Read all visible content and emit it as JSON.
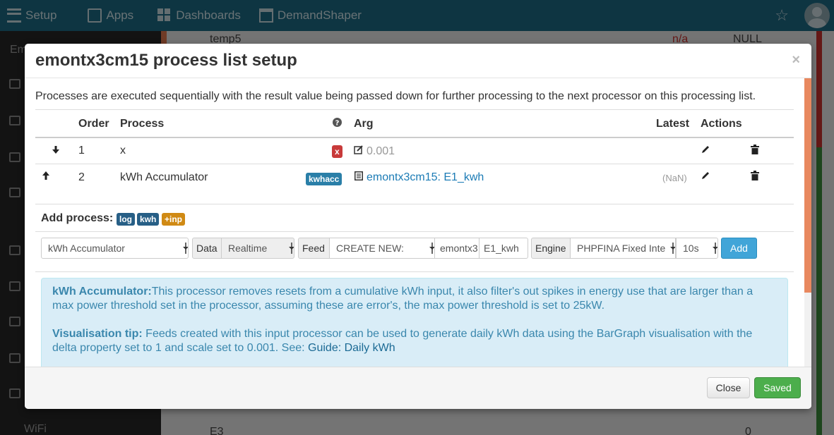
{
  "topnav": {
    "setup": "Setup",
    "apps": "Apps",
    "dashboards": "Dashboards",
    "demandshaper": "DemandShaper"
  },
  "background": {
    "sidebar_partial": "Em",
    "sidebar_wifi": "WiFi",
    "row_top_name": "temp5",
    "row_top_value": "n/a",
    "row_top_null": "NULL",
    "row_bottom_name": "E3",
    "row_bottom_value": "0"
  },
  "modal": {
    "title": "emontx3cm15 process list setup",
    "close_symbol": "×",
    "intro": "Processes are executed sequentially with the result value being passed down for further processing to the next processor on this processing list.",
    "table": {
      "headers": {
        "order": "Order",
        "process": "Process",
        "arg": "Arg",
        "latest": "Latest",
        "actions": "Actions"
      },
      "rows": [
        {
          "order": "1",
          "process": "x",
          "badge": "x",
          "arg": "0.001",
          "latest": ""
        },
        {
          "order": "2",
          "process": "kWh Accumulator",
          "badge": "kwhacc",
          "arg": "emontx3cm15: E1_kwh",
          "latest": "(NaN)"
        }
      ]
    },
    "add_process": {
      "label": "Add process:",
      "tags": [
        "log",
        "kwh",
        "+inp"
      ],
      "process_select": "kWh Accumulator",
      "data_label": "Data",
      "data_select": "Realtime",
      "feed_label": "Feed",
      "feed_select": "CREATE NEW:",
      "feed_tag": "emontx3",
      "feed_name": "E1_kwh",
      "engine_label": "Engine",
      "engine_select": "PHPFINA Fixed Inte",
      "interval_select": "10s",
      "add_button": "Add"
    },
    "info": {
      "title": "kWh Accumulator:",
      "text": "This processor removes resets from a cumulative kWh input, it also filter's out spikes in energy use that are larger than a max power threshold set in the processor, assuming these are error's, the max power threshold is set to 25kW.",
      "tip_title": "Visualisation tip:",
      "tip_text": " Feeds created with this input processor can be used to generate daily kWh data using the BarGraph visualisation with the delta property set to 1 and scale set to 0.001. See: ",
      "tip_link": "Guide: Daily kWh"
    },
    "footer": {
      "close": "Close",
      "saved": "Saved"
    }
  },
  "colors": {
    "topbar": "#1c6a85",
    "add_button": "#41a5d8",
    "saved_button": "#4cae4c",
    "alert_bg": "#d9edf7"
  }
}
